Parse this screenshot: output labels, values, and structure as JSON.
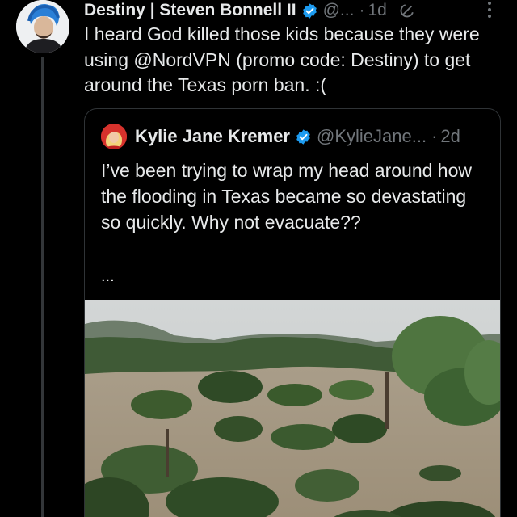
{
  "tweet": {
    "author_name": "Destiny | Steven Bonnell II",
    "handle": "@...",
    "separator": "·",
    "time": "1d",
    "text": "I heard God killed those kids because they were using @NordVPN (promo code: Destiny) to get around the Texas porn ban. :("
  },
  "quote": {
    "author_name": "Kylie Jane Kremer",
    "handle": "@KylieJane...",
    "separator": "·",
    "time": "2d",
    "text": "I’ve been trying to wrap my head around how the flooding in Texas became so devastating so quickly. Why not evacuate??",
    "ellipsis": "..."
  },
  "colors": {
    "background": "#000000",
    "text": "#e7e9ea",
    "muted": "#71767b",
    "verified": "#1d9bf0",
    "border": "#2f3336"
  },
  "icons": {
    "verified": "verified-badge-icon",
    "grok": "grok-icon",
    "more": "more-options-icon"
  }
}
